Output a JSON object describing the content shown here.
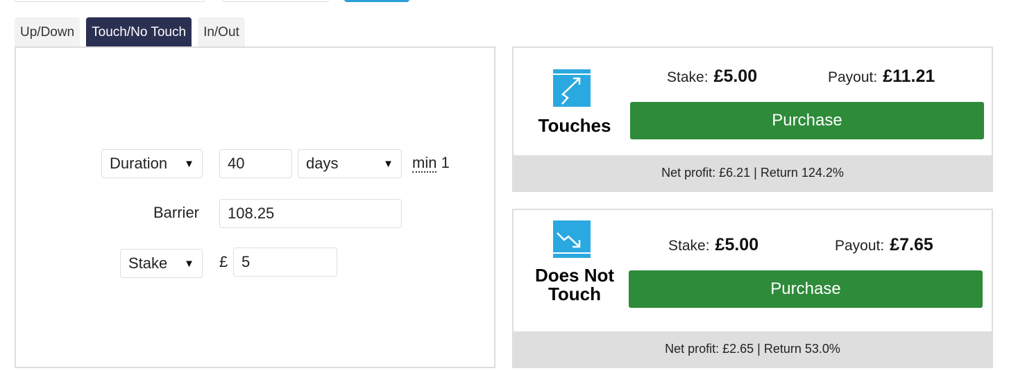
{
  "tabs": [
    {
      "label": "Up/Down",
      "active": false
    },
    {
      "label": "Touch/No Touch",
      "active": true
    },
    {
      "label": "In/Out",
      "active": false
    }
  ],
  "form": {
    "duration_select": "Duration",
    "duration_value": "40",
    "duration_unit": "days",
    "min_label": "min",
    "min_value": "1",
    "barrier_label": "Barrier",
    "barrier_value": "108.25",
    "amount_type_select": "Stake",
    "currency_symbol": "£",
    "stake_value": "5"
  },
  "contracts": [
    {
      "name": "Touches",
      "icon": "touch-icon",
      "stake_label": "Stake:",
      "stake": "£5.00",
      "payout_label": "Payout:",
      "payout": "£11.21",
      "button_label": "Purchase",
      "net_profit": "Net profit: £6.21 | Return 124.2%"
    },
    {
      "name": "Does Not Touch",
      "icon": "no-touch-icon",
      "stake_label": "Stake:",
      "stake": "£5.00",
      "payout_label": "Payout:",
      "payout": "£7.65",
      "button_label": "Purchase",
      "net_profit": "Net profit: £2.65 | Return 53.0%"
    }
  ],
  "colors": {
    "active_tab": "#2a3052",
    "purchase_button": "#2e8b3a",
    "icon_blue": "#2aa8e0",
    "profit_bar": "#dedede"
  }
}
